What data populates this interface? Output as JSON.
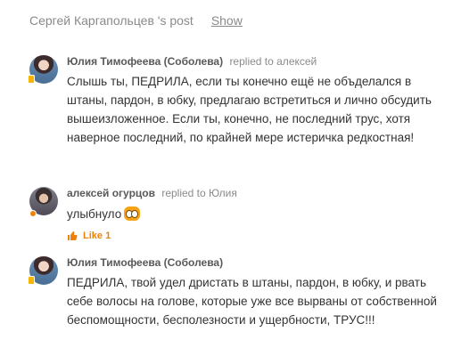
{
  "post_header": {
    "title": "Сергей Каргапольцев 's post",
    "show_label": "Show"
  },
  "comments": [
    {
      "author": "Юлия Тимофеева (Соболева)",
      "replied_to": "replied to алексей",
      "text": "Слышь ты, ПЕДРИЛА, если ты конечно ещё не объделался в штаны, пардон, в юбку, предлагаю встретиться и лично обсудить вышеизложенное. Если ты, конечно, не последний трус, хотя наверное последний, по крайней мере истеричка редкостная!",
      "status_color": "#f7b500"
    },
    {
      "author": "алексей огурцов",
      "replied_to": "replied to Юлия",
      "text": "улыбнуло",
      "emoji": "surprised-face-icon",
      "like_label": "Like",
      "like_count": "1",
      "status_color": "#ee8208"
    },
    {
      "author": "Юлия Тимофеева (Соболева)",
      "replied_to": "",
      "text": "ПЕДРИЛА, твой удел дристать в штаны, пардон, в юбку, и рвать себе волосы на голове, которые уже все вырваны от собственной беспомощности, бесполезности и ущербности, ТРУС!!!",
      "status_color": "#f7b500"
    }
  ]
}
